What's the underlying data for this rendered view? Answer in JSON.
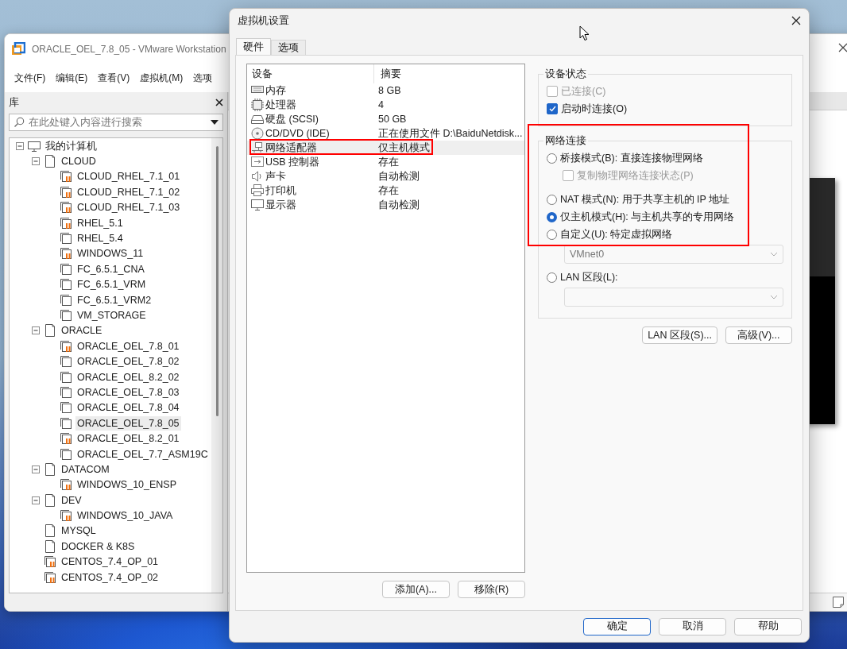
{
  "workstation": {
    "title": "ORACLE_OEL_7.8_05 - VMware Workstation",
    "menu": [
      "文件(F)",
      "编辑(E)",
      "查看(V)",
      "虚拟机(M)",
      "选项"
    ],
    "library": {
      "title": "库",
      "search_placeholder": "在此处键入内容进行搜索",
      "tree": [
        {
          "kind": "computer",
          "label": "我的计算机",
          "expanded": true,
          "selected": false,
          "children": [
            {
              "kind": "folder",
              "label": "CLOUD",
              "expanded": true,
              "selected": false,
              "children": [
                {
                  "kind": "vm",
                  "label": "CLOUD_RHEL_7.1_01",
                  "running": true,
                  "selected": false
                },
                {
                  "kind": "vm",
                  "label": "CLOUD_RHEL_7.1_02",
                  "running": true,
                  "selected": false
                },
                {
                  "kind": "vm",
                  "label": "CLOUD_RHEL_7.1_03",
                  "running": true,
                  "selected": false
                },
                {
                  "kind": "vm",
                  "label": "RHEL_5.1",
                  "running": true,
                  "selected": false
                },
                {
                  "kind": "vm",
                  "label": "RHEL_5.4",
                  "running": false,
                  "selected": false
                },
                {
                  "kind": "vm",
                  "label": "WINDOWS_11",
                  "running": true,
                  "selected": false
                },
                {
                  "kind": "vm",
                  "label": "FC_6.5.1_CNA",
                  "running": false,
                  "selected": false
                },
                {
                  "kind": "vm",
                  "label": "FC_6.5.1_VRM",
                  "running": false,
                  "selected": false
                },
                {
                  "kind": "vm",
                  "label": "FC_6.5.1_VRM2",
                  "running": false,
                  "selected": false
                },
                {
                  "kind": "vm",
                  "label": "VM_STORAGE",
                  "running": false,
                  "selected": false
                }
              ]
            },
            {
              "kind": "folder",
              "label": "ORACLE",
              "expanded": true,
              "selected": false,
              "children": [
                {
                  "kind": "vm",
                  "label": "ORACLE_OEL_7.8_01",
                  "running": true,
                  "selected": false
                },
                {
                  "kind": "vm",
                  "label": "ORACLE_OEL_7.8_02",
                  "running": false,
                  "selected": false
                },
                {
                  "kind": "vm",
                  "label": "ORACLE_OEL_8.2_02",
                  "running": false,
                  "selected": false
                },
                {
                  "kind": "vm",
                  "label": "ORACLE_OEL_7.8_03",
                  "running": false,
                  "selected": false
                },
                {
                  "kind": "vm",
                  "label": "ORACLE_OEL_7.8_04",
                  "running": false,
                  "selected": false
                },
                {
                  "kind": "vm",
                  "label": "ORACLE_OEL_7.8_05",
                  "running": false,
                  "selected": true
                },
                {
                  "kind": "vm",
                  "label": "ORACLE_OEL_8.2_01",
                  "running": true,
                  "selected": false
                },
                {
                  "kind": "vm",
                  "label": "ORACLE_OEL_7.7_ASM19C",
                  "running": false,
                  "selected": false
                }
              ]
            },
            {
              "kind": "folder",
              "label": "DATACOM",
              "expanded": true,
              "selected": false,
              "children": [
                {
                  "kind": "vm",
                  "label": "WINDOWS_10_ENSP",
                  "running": true,
                  "selected": false
                }
              ]
            },
            {
              "kind": "folder",
              "label": "DEV",
              "expanded": true,
              "selected": false,
              "children": [
                {
                  "kind": "vm",
                  "label": "WINDOWS_10_JAVA",
                  "running": true,
                  "selected": false
                }
              ]
            },
            {
              "kind": "folder",
              "label": "MYSQL",
              "selected": false
            },
            {
              "kind": "folder",
              "label": "DOCKER & K8S",
              "selected": false
            },
            {
              "kind": "vm",
              "label": "CENTOS_7.4_OP_01",
              "running": true,
              "selected": false
            },
            {
              "kind": "vm",
              "label": "CENTOS_7.4_OP_02",
              "running": true,
              "selected": false
            }
          ]
        }
      ]
    }
  },
  "dialog": {
    "title": "虚拟机设置",
    "tabs": [
      {
        "label": "硬件",
        "selected": true
      },
      {
        "label": "选项",
        "selected": false
      }
    ],
    "devices": {
      "columns": [
        "设备",
        "摘要"
      ],
      "rows": [
        {
          "kind": "memory",
          "name": "内存",
          "summary": "8 GB",
          "selected": false,
          "annotated": false
        },
        {
          "kind": "cpu",
          "name": "处理器",
          "summary": "4",
          "selected": false,
          "annotated": false
        },
        {
          "kind": "disk",
          "name": "硬盘 (SCSI)",
          "summary": "50 GB",
          "selected": false,
          "annotated": false
        },
        {
          "kind": "cdrom",
          "name": "CD/DVD (IDE)",
          "summary": "正在使用文件 D:\\BaiduNetdisk...",
          "selected": false,
          "annotated": false
        },
        {
          "kind": "network",
          "name": "网络适配器",
          "summary": "仅主机模式",
          "selected": true,
          "annotated": true
        },
        {
          "kind": "usb",
          "name": "USB 控制器",
          "summary": "存在",
          "selected": false,
          "annotated": false
        },
        {
          "kind": "sound",
          "name": "声卡",
          "summary": "自动检测",
          "selected": false,
          "annotated": false
        },
        {
          "kind": "printer",
          "name": "打印机",
          "summary": "存在",
          "selected": false,
          "annotated": false
        },
        {
          "kind": "display",
          "name": "显示器",
          "summary": "自动检测",
          "selected": false,
          "annotated": false
        }
      ]
    },
    "list_buttons": [
      "添加(A)...",
      "移除(R)"
    ],
    "device_status": {
      "title": "设备状态",
      "options": [
        {
          "label": "已连接(C)",
          "checked": false,
          "disabled": true
        },
        {
          "label": "启动时连接(O)",
          "checked": true,
          "disabled": false
        }
      ]
    },
    "network": {
      "title": "网络连接",
      "annotated": true,
      "options": [
        {
          "kind": "radio",
          "label": "桥接模式(B): 直接连接物理网络",
          "selected": false
        },
        {
          "kind": "subcheckbox",
          "label": "复制物理网络连接状态(P)",
          "checked": false,
          "disabled": true
        },
        {
          "kind": "radio",
          "label": "NAT 模式(N): 用于共享主机的 IP 地址",
          "selected": false
        },
        {
          "kind": "radio",
          "label": "仅主机模式(H): 与主机共享的专用网络",
          "selected": true
        },
        {
          "kind": "radio",
          "label": "自定义(U): 特定虚拟网络",
          "selected": false
        },
        {
          "kind": "dropdown",
          "value": "VMnet0",
          "disabled": true
        },
        {
          "kind": "radio",
          "label": "LAN 区段(L):",
          "selected": false
        },
        {
          "kind": "dropdown",
          "disabled": true
        }
      ]
    },
    "side_buttons": [
      "LAN 区段(S)...",
      "高级(V)..."
    ],
    "footer_buttons": [
      {
        "label": "确定",
        "default": true
      },
      {
        "label": "取消",
        "default": false
      },
      {
        "label": "帮助",
        "default": false
      }
    ]
  }
}
